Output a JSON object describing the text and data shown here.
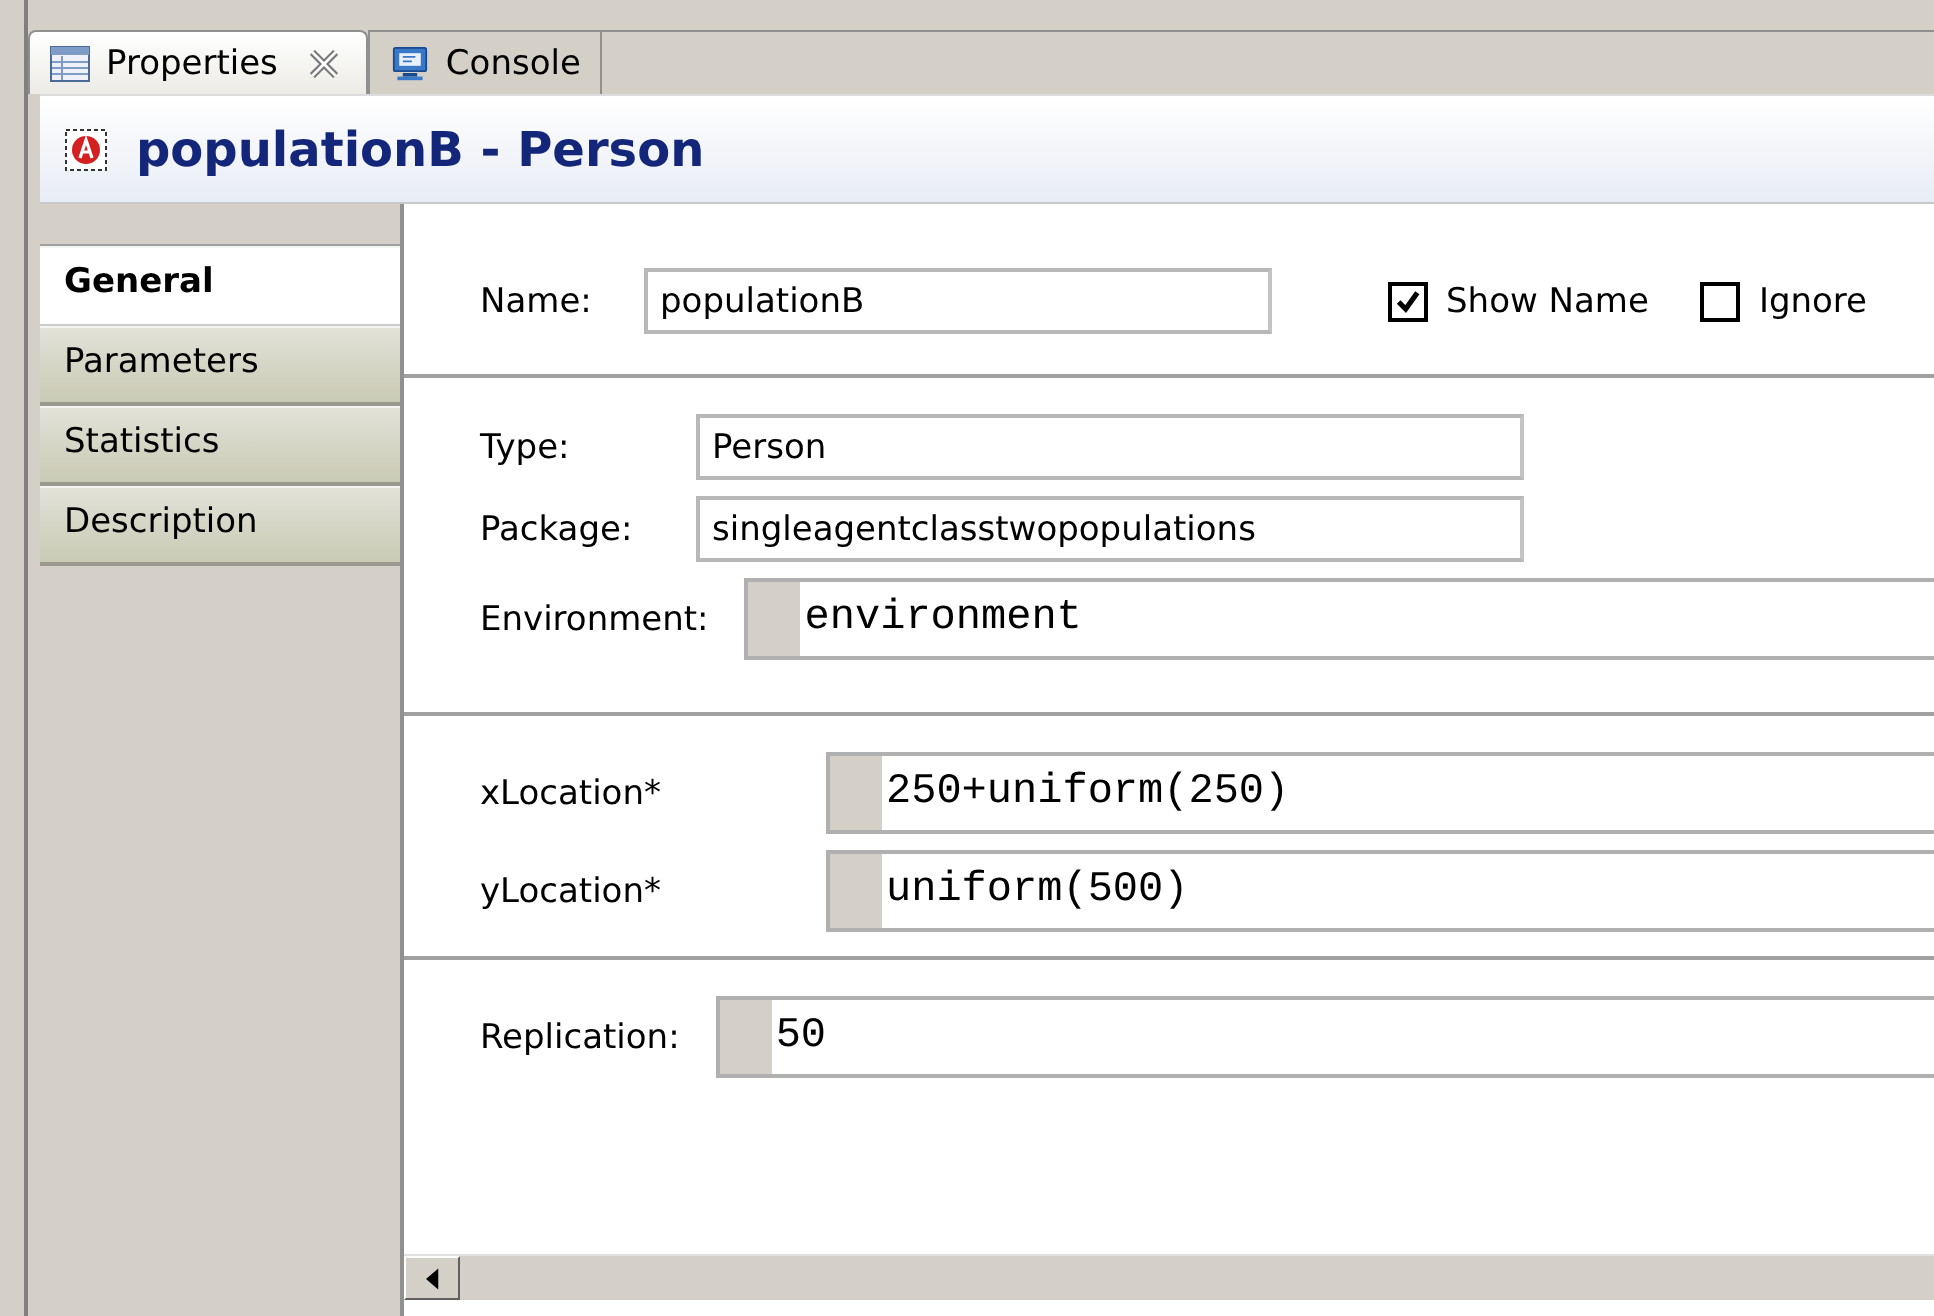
{
  "tabs": [
    {
      "label": "Properties",
      "kind": "table",
      "closable": true,
      "selected": true
    },
    {
      "label": "Console",
      "kind": "monitor",
      "closable": false,
      "selected": false
    }
  ],
  "header": {
    "title": "populationB - Person"
  },
  "sidebar": {
    "items": [
      {
        "label": "General",
        "selected": true
      },
      {
        "label": "Parameters",
        "selected": false
      },
      {
        "label": "Statistics",
        "selected": false
      },
      {
        "label": "Description",
        "selected": false
      }
    ]
  },
  "name_row": {
    "label": "Name:",
    "value": "populationB",
    "checkboxes": [
      {
        "label": "Show Name",
        "checked": true
      },
      {
        "label": "Ignore",
        "checked": false
      }
    ]
  },
  "sections": [
    {
      "rows": [
        {
          "kind": "text",
          "label": "Type:",
          "value": "Person"
        },
        {
          "kind": "text",
          "label": "Package:",
          "value": "singleagentclasstwopopulations"
        },
        {
          "kind": "code",
          "label": "Environment:",
          "value": "environment"
        }
      ]
    },
    {
      "rows": [
        {
          "kind": "code",
          "label": "xLocation*",
          "value": "250+uniform(250)"
        },
        {
          "kind": "code",
          "label": "yLocation*",
          "value": "uniform(500)"
        }
      ]
    },
    {
      "rows": [
        {
          "kind": "code",
          "label": "Replication:",
          "value": "50"
        }
      ]
    }
  ]
}
